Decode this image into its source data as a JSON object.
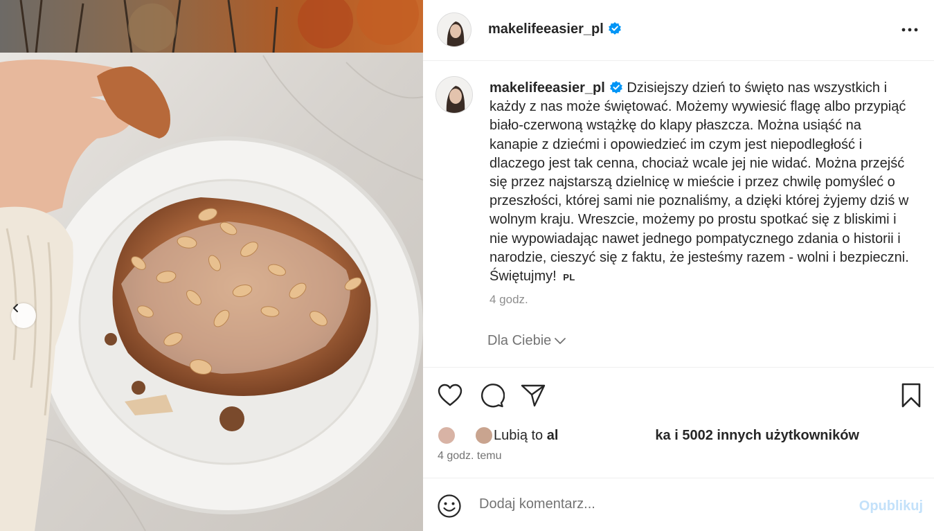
{
  "post": {
    "username": "makelifeeasier_pl",
    "caption_username": "makelifeeasier_pl",
    "caption": "Dzisiejszy dzień to święto nas wszystkich i każdy z nas może świętować. Możemy wywiesić flagę albo przypiąć biało-czerwoną wstążkę do klapy płaszcza. Można usiąść na kanapie z dziećmi i opowiedzieć im czym jest niepodległość i dlaczego jest tak cenna, chociaż wcale jej nie widać. Można przejść się przez najstarszą dzielnicę w mieście i przez chwilę pomyśleć o przeszłości, której sami nie poznaliśmy, a dzięki której żyjemy dziś w wolnym kraju. Wreszcie, możemy po prostu spotkać się z bliskimi i nie wypowiadając nawet jednego pompatycznego zdania o historii i narodzie, cieszyć się z faktu, że jesteśmy razem - wolni i bezpieczni. Świętujmy!",
    "lang_badge": "PL",
    "caption_time": "4 godz.",
    "for_you_label": "Dla Ciebie",
    "likes_prefix": "Lubią to ",
    "likes_name_start": "al",
    "likes_name_end": "ka",
    "likes_suffix": " i 5002 innych użytkowników",
    "posted_ago": "4 godz. temu"
  },
  "comment": {
    "placeholder": "Dodaj komentarz...",
    "publish_label": "Opublikuj"
  },
  "icons": {
    "more": "more-horizontal-icon",
    "like": "heart-icon",
    "comment": "comment-icon",
    "share": "paper-plane-icon",
    "save": "bookmark-icon",
    "emoji": "emoji-icon",
    "prev": "chevron-left-icon",
    "verified": "verified-badge-icon",
    "foryou_chevron": "chevron-down-icon"
  },
  "colors": {
    "verified": "#0095f6",
    "publish_disabled": "#c3e1fa",
    "secondary_text": "#737373"
  }
}
